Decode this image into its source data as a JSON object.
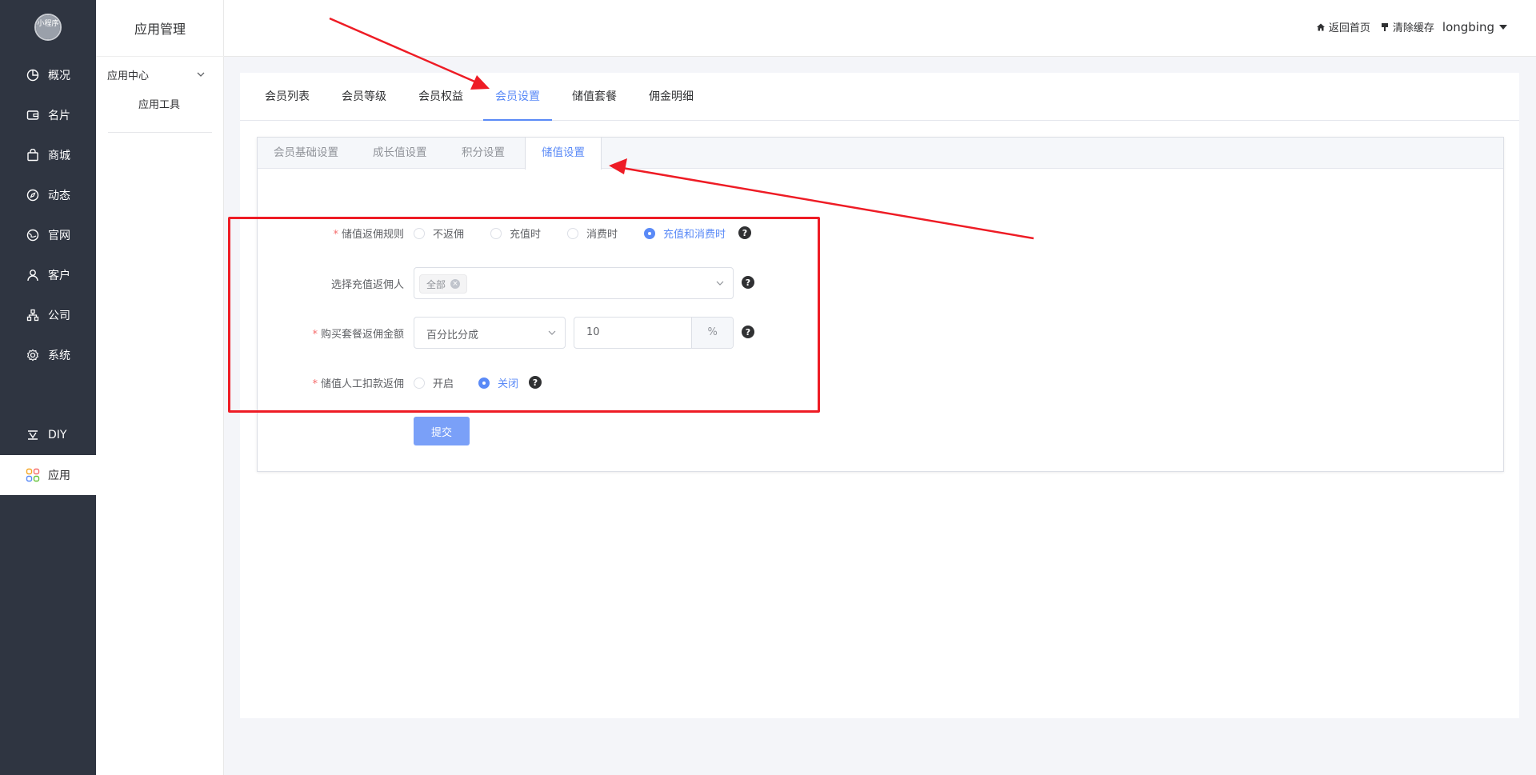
{
  "sidebar": {
    "logo_text": "小程序",
    "items": [
      {
        "label": "概况",
        "icon": "pie-chart-icon"
      },
      {
        "label": "名片",
        "icon": "wallet-icon"
      },
      {
        "label": "商城",
        "icon": "shopping-bag-icon"
      },
      {
        "label": "动态",
        "icon": "compass-icon"
      },
      {
        "label": "官网",
        "icon": "globe-icon"
      },
      {
        "label": "客户",
        "icon": "user-icon"
      },
      {
        "label": "公司",
        "icon": "org-chart-icon"
      },
      {
        "label": "系统",
        "icon": "gear-icon"
      },
      {
        "label": "DIY",
        "icon": "diy-icon"
      },
      {
        "label": "应用",
        "icon": "apps-icon",
        "active": true
      }
    ]
  },
  "submenu": {
    "title": "应用管理",
    "group": "应用中心",
    "item": "应用工具"
  },
  "header": {
    "home_link": "返回首页",
    "clear_cache": "清除缓存",
    "username": "longbing"
  },
  "top_tabs": {
    "items": [
      "会员列表",
      "会员等级",
      "会员权益",
      "会员设置",
      "储值套餐",
      "佣金明细"
    ],
    "active": "会员设置"
  },
  "inner_tabs": {
    "items": [
      "会员基础设置",
      "成长值设置",
      "积分设置",
      "储值设置"
    ],
    "active": "储值设置"
  },
  "form": {
    "rule_label": "储值返佣规则",
    "rule_options": [
      "不返佣",
      "充值时",
      "消费时",
      "充值和消费时"
    ],
    "rule_selected": "充值和消费时",
    "recipient_label": "选择充值返佣人",
    "recipient_tag": "全部",
    "amount_label": "购买套餐返佣金额",
    "amount_mode": "百分比分成",
    "amount_value": "10",
    "amount_suffix": "%",
    "manual_label": "储值人工扣款返佣",
    "manual_options": [
      "开启",
      "关闭"
    ],
    "manual_selected": "关闭",
    "help_mark": "?",
    "submit_label": "提交"
  },
  "colors": {
    "accent": "#5a8af7",
    "sidebar_bg": "#2f3541",
    "annotation_red": "#ee1c25"
  }
}
